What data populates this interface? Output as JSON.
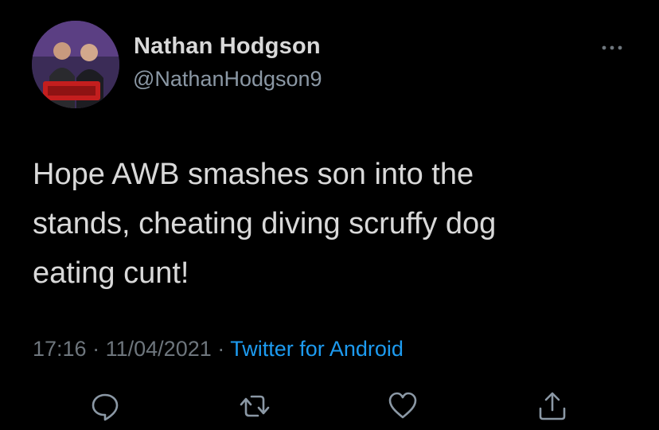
{
  "author": {
    "display_name": "Nathan Hodgson",
    "handle": "@NathanHodgson9",
    "avatar_icon": "profile-photo"
  },
  "tweet": {
    "text_lines": [
      "Hope AWB smashes son into the",
      "stands, cheating diving scruffy dog",
      "eating cunt!"
    ],
    "time": "17:16",
    "separator": "·",
    "date": "11/04/2021",
    "source": "Twitter for Android"
  },
  "menu": {
    "more_icon": "more-horizontal-icon"
  },
  "actions": [
    {
      "name": "reply",
      "icon": "reply-icon"
    },
    {
      "name": "retweet",
      "icon": "retweet-icon"
    },
    {
      "name": "like",
      "icon": "heart-icon"
    },
    {
      "name": "share",
      "icon": "share-icon"
    }
  ],
  "colors": {
    "background": "#000000",
    "text": "#d9d9d9",
    "secondary": "#8b98a5",
    "meta": "#6e767d",
    "link": "#1d9bf0",
    "icon": "#8b98a5"
  }
}
